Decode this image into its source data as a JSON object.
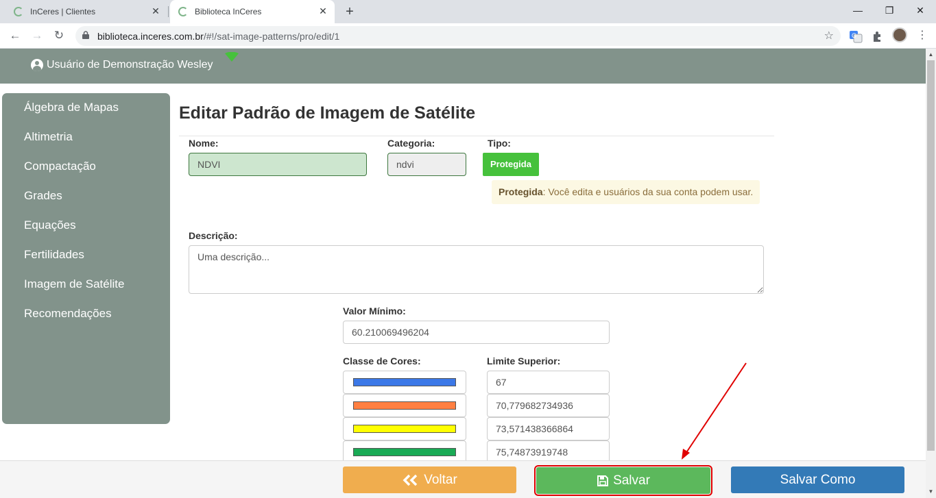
{
  "browser": {
    "tabs": [
      {
        "title": "InCeres | Clientes",
        "active": false
      },
      {
        "title": "Biblioteca InCeres",
        "active": true
      }
    ],
    "url_host": "biblioteca.inceres.com.br",
    "url_path": "/#!/sat-image-patterns/pro/edit/1"
  },
  "header": {
    "user_name": "Usuário de Demonstração Wesley"
  },
  "sidebar": {
    "items": [
      "Álgebra de Mapas",
      "Altimetria",
      "Compactação",
      "Grades",
      "Equações",
      "Fertilidades",
      "Imagem de Satélite",
      "Recomendações"
    ]
  },
  "main": {
    "title": "Editar Padrão de Imagem de Satélite",
    "name_label": "Nome:",
    "name_value": "NDVI",
    "category_label": "Categoria:",
    "category_value": "ndvi",
    "type_label": "Tipo:",
    "type_badge": "Protegida",
    "type_note_bold": "Protegida",
    "type_note_text": ": Você edita e usuários da sua conta podem usar.",
    "description_label": "Descrição:",
    "description_placeholder": "Uma descrição...",
    "min_value_label": "Valor Mínimo:",
    "min_value": "60.210069496204",
    "color_classes_label": "Classe de Cores:",
    "upper_limit_label": "Limite Superior:",
    "classes": [
      {
        "color": "#3b78e7",
        "limit": "67"
      },
      {
        "color": "#ff7f41",
        "limit": "70,779682734936"
      },
      {
        "color": "#ffff00",
        "limit": "73,571438366864"
      },
      {
        "color": "#1aaa55",
        "limit": "75,74873919748"
      }
    ]
  },
  "footer": {
    "back_label": "Voltar",
    "save_label": "Salvar",
    "save_as_label": "Salvar Como"
  },
  "colors": {
    "header_bg": "#82938b",
    "badge_green": "#46c13c",
    "back_orange": "#f0ad4e",
    "save_green": "#5cb85c",
    "save_as_blue": "#337ab7",
    "highlight_red": "#e00000"
  }
}
